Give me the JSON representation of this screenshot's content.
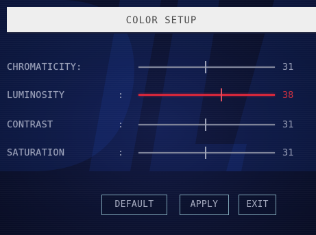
{
  "title": "COLOR SETUP",
  "settings": [
    {
      "label": "CHROMATICITY:",
      "colon": "",
      "value": "31",
      "level": 0.49,
      "selected": false
    },
    {
      "label": "LUMINOSITY",
      "colon": ":",
      "value": "38",
      "level": 0.61,
      "selected": true
    },
    {
      "label": "CONTRAST",
      "colon": ":",
      "value": "31",
      "level": 0.49,
      "selected": false
    },
    {
      "label": "SATURATION",
      "colon": ":",
      "value": "31",
      "level": 0.49,
      "selected": false
    }
  ],
  "buttons": {
    "default_label": "DEFAULT",
    "apply_label": "APPLY",
    "exit_label": "EXIT"
  },
  "colors": {
    "background": "#0c1230",
    "title_bar": "#eeeeee",
    "text": "#9aa0b8",
    "selected_accent": "#d4263a",
    "button_border": "#7fa6b8"
  }
}
